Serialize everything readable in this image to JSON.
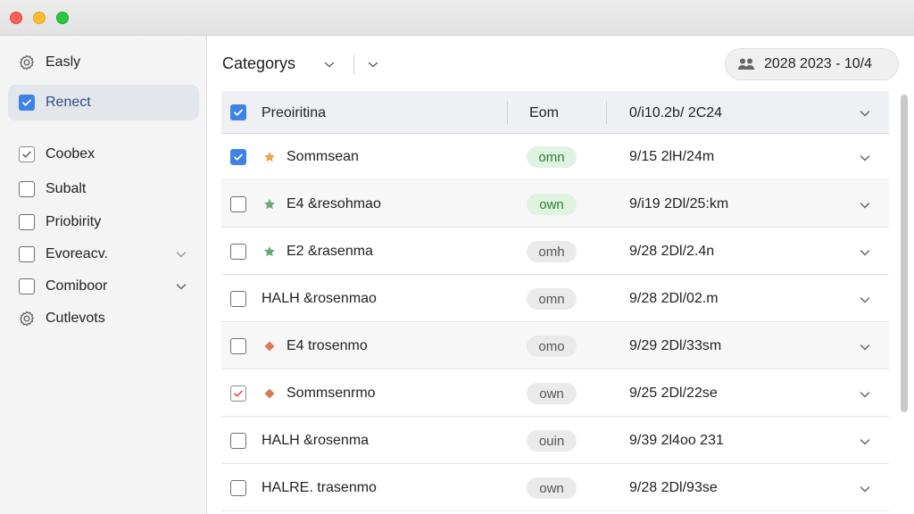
{
  "sidebar": {
    "items": [
      {
        "label": "Easly",
        "icon": "gear-icon",
        "active": false
      },
      {
        "label": "Renect",
        "icon": "checkbox-checked-icon",
        "active": true
      },
      {
        "label": "Coobex",
        "icon": "checkbox-tick-icon",
        "active": false
      },
      {
        "label": "Subalt",
        "icon": "checkbox-empty-icon",
        "active": false
      },
      {
        "label": "Priobirity",
        "icon": "checkbox-empty-icon",
        "active": false
      },
      {
        "label": "Evoreacv.",
        "icon": "checkbox-empty-icon",
        "active": false,
        "has_chevron": true
      },
      {
        "label": "Comiboor",
        "icon": "checkbox-empty-icon",
        "active": false,
        "has_chevron": true
      },
      {
        "label": "Cutlevots",
        "icon": "gear-icon",
        "active": false
      }
    ]
  },
  "toolbar": {
    "title": "Categorys",
    "date_range": "2028 2023 - 10/4",
    "date_icon": "people-icon"
  },
  "table": {
    "header": {
      "name": "Preoiritina",
      "col2": "Eom",
      "date": "0/i10.2b/ 2C24"
    },
    "rows": [
      {
        "name": "Sommsean",
        "marker": "star",
        "marker_color": "#e8a94a",
        "pill": "omn",
        "pill_style": "green",
        "date": "9/15 2lH/24m",
        "checked": true
      },
      {
        "name": "E4 &resohmao",
        "marker": "star",
        "marker_color": "#6aa876",
        "pill": "own",
        "pill_style": "green",
        "date": "9/i19 2Dl/25:km",
        "checked": false
      },
      {
        "name": "E2 &rasenma",
        "marker": "star",
        "marker_color": "#6aa876",
        "pill": "omh",
        "pill_style": "gray",
        "date": "9/28 2Dl/2.4n",
        "checked": false
      },
      {
        "name": "HALH &rosenmao",
        "marker": "none",
        "pill": "omn",
        "pill_style": "gray",
        "date": "9/28 2Dl/02.m",
        "checked": false
      },
      {
        "name": "E4 trosenmo",
        "marker": "diamond",
        "marker_color": "#d97b58",
        "pill": "omo",
        "pill_style": "gray",
        "date": "9/29 2Dl/33sm",
        "checked": false
      },
      {
        "name": "Sommsenrmo",
        "marker": "diamond",
        "marker_color": "#d97b58",
        "pill": "own",
        "pill_style": "gray",
        "date": "9/25 2Dl/22se",
        "checked": "outline"
      },
      {
        "name": "HALH &rosenma",
        "marker": "none",
        "pill": "ouin",
        "pill_style": "gray",
        "date": "9/39 2l4oo 231",
        "checked": false
      },
      {
        "name": "HALRE. trasenmo",
        "marker": "none",
        "pill": "own",
        "pill_style": "gray",
        "date": "9/28 2Dl/93se",
        "checked": false
      }
    ]
  },
  "colors": {
    "accent": "#3d82e6",
    "active_bg": "#e3e6ea",
    "pill_green_bg": "#dff3e1",
    "pill_green_text": "#2f7a3a"
  }
}
